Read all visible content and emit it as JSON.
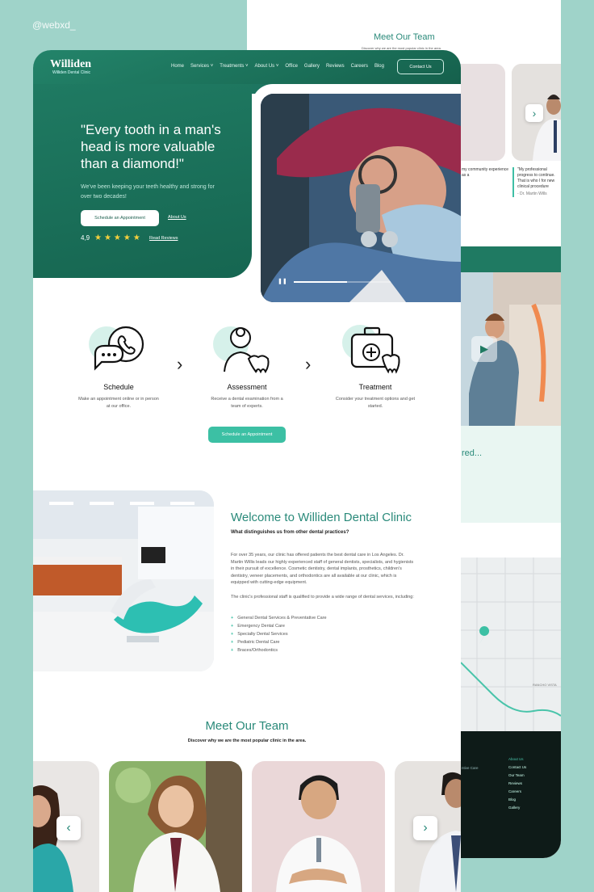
{
  "watermark": "@webxd_",
  "background_page": {
    "team_title": "Meet Our Team",
    "team_sub": "Discover why we are the most popular clinic in the area.",
    "quote_left": "my community experience as a",
    "quote_right": "\"My professional progress to continue. That is who I for new clinical procedure",
    "quote_right_author": "- Dr. Martin Wills",
    "partial_heading": "red...",
    "map_labels": [
      "RANCHO VISTA"
    ],
    "footer_links": [
      "About Us",
      "Contact Us",
      "Our Team",
      "Reviews",
      "Careers",
      "Blog",
      "Gallery"
    ],
    "footer_partial": "ntive Care"
  },
  "header": {
    "logo": "Williden",
    "logo_sub": "Williden Dental Clinic",
    "nav": [
      "Home",
      "Services ˅",
      "Treatments ˅",
      "About Us ˅",
      "Office",
      "Gallery",
      "Reviews",
      "Careers",
      "Blog"
    ],
    "contact_label": "Contact Us"
  },
  "hero": {
    "quote": "\"Every tooth in a man's head is more valuable than a diamond!\"",
    "subtext": "We've been keeping your teeth healthy and strong for over two decades!",
    "primary_button": "Schedule an Appointment",
    "secondary_link": "About Us",
    "rating": "4,9",
    "stars": "★★★★★",
    "reviews_link": "Read Reviews",
    "video_progress": 0.55
  },
  "steps": [
    {
      "title": "Schedule",
      "desc": "Make an appointment online or in person at our office.",
      "icon": "phone-chat-icon"
    },
    {
      "title": "Assessment",
      "desc": "Receive a dental examination from a team of experts.",
      "icon": "dentist-icon"
    },
    {
      "title": "Treatment",
      "desc": "Consider your treatment options and get started.",
      "icon": "medical-kit-tooth-icon"
    }
  ],
  "steps_button": "Schedule an Appointment",
  "welcome": {
    "title": "Welcome to Williden Dental Clinic",
    "subtitle": "What distinguishes us from other dental practices?",
    "p1": "For over 35 years, our clinic has offered patients the best dental care in Los Angeles. Dr. Martin Willis leads our highly experienced staff of general dentists, specialists, and hygienists in their pursuit of excellence. Cosmetic dentistry, dental implants, prosthetics, children's dentistry, veneer placements, and orthodontics are all available at our clinic, which is equipped with cutting-edge equipment.",
    "p2": "The clinic's professional staff is qualified to provide a wide range of dental services, including:",
    "services": [
      "General Dental Services & Preventative Care",
      "Emergency Dental Care",
      "Specialty Dental Services",
      "Pediatric Dental Care",
      "Braces/Orthodontics"
    ]
  },
  "team": {
    "title": "Meet Our Team",
    "subtitle": "Discover why we are the most popular clinic in the area."
  },
  "colors": {
    "brand_green": "#1f7a62",
    "accent_teal": "#3cc0a4",
    "backdrop": "#9fd3c9"
  }
}
